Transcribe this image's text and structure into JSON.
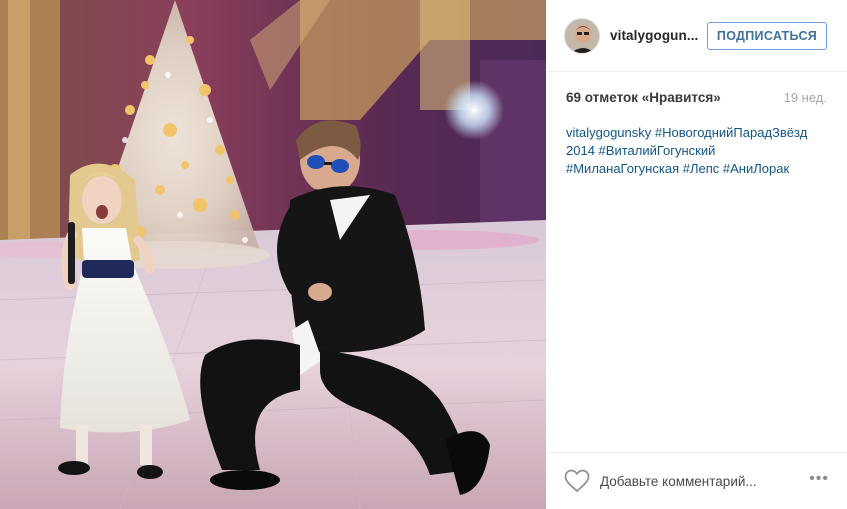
{
  "post": {
    "author": {
      "username": "vitalygogun...",
      "avatar_icon": "avatar-photo-icon"
    },
    "follow_label": "ПОДПИСАТЬСЯ",
    "likes_text": "69 отметок «Нравится»",
    "age_text": "19 нед.",
    "caption": {
      "author": "vitalygogunsky",
      "tags": [
        "#НовогоднийПарадЗвёзд2014",
        "#ВиталийГогунский",
        "#МиланаГогунская",
        "#Лепс",
        "#АниЛорак"
      ],
      "line1_tag_part": "#НовогоднийПарадЗвёзд",
      "line2_prefix": "2014",
      "line2_tag": "#ВиталийГогунский",
      "line3_tag1": "#МиланаГогунская",
      "line3_tag2": "#Лепс",
      "line3_tag3": "#АниЛорак"
    },
    "comment_placeholder": "Добавьте комментарий...",
    "more_label": "•••",
    "icons": {
      "like": "heart-outline-icon",
      "more": "more-options-icon"
    },
    "colors": {
      "link": "#125688",
      "follow_text": "#3f729b",
      "follow_border": "#6fa0d6",
      "muted": "#a5a7aa"
    }
  }
}
